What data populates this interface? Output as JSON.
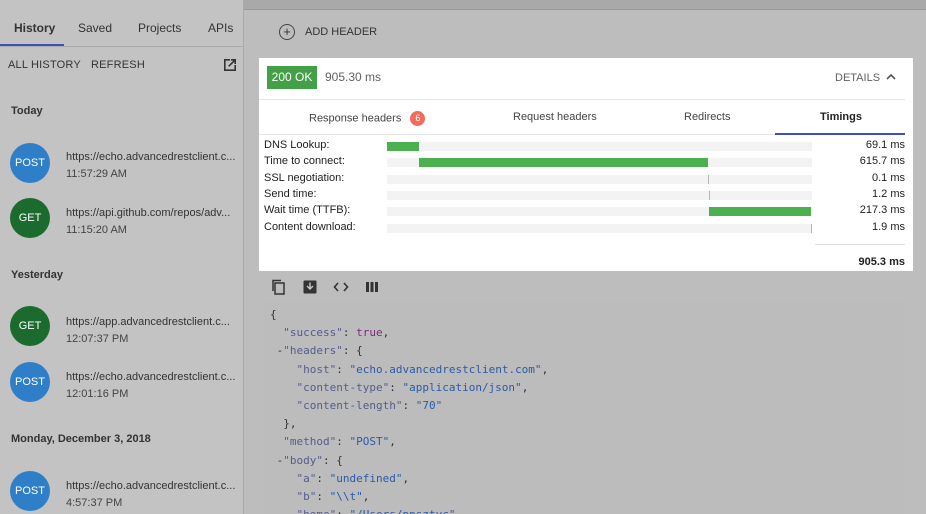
{
  "sidebar": {
    "tabs": [
      {
        "label": "History"
      },
      {
        "label": "Saved"
      },
      {
        "label": "Projects"
      },
      {
        "label": "APIs"
      }
    ],
    "actions": {
      "all_history": "ALL HISTORY",
      "refresh": "REFRESH"
    },
    "sections": [
      {
        "heading": "Today",
        "items": [
          {
            "method": "POST",
            "url": "https://echo.advancedrestclient.c...",
            "time": "11:57:29 AM"
          },
          {
            "method": "GET",
            "url": "https://api.github.com/repos/adv...",
            "time": "11:15:20 AM"
          }
        ]
      },
      {
        "heading": "Yesterday",
        "items": [
          {
            "method": "GET",
            "url": "https://app.advancedrestclient.c...",
            "time": "12:07:37 PM"
          },
          {
            "method": "POST",
            "url": "https://echo.advancedrestclient.c...",
            "time": "12:01:16 PM"
          }
        ]
      },
      {
        "heading": "Monday, December 3, 2018",
        "items": [
          {
            "method": "POST",
            "url": "https://echo.advancedrestclient.c...",
            "time": "4:57:37 PM"
          }
        ]
      }
    ]
  },
  "main": {
    "add_header": "ADD HEADER",
    "response": {
      "status": "200 OK",
      "load_time": "905.30 ms",
      "details": "DETAILS",
      "tabs": [
        {
          "label": "Response headers",
          "badge": "6"
        },
        {
          "label": "Request headers"
        },
        {
          "label": "Redirects"
        },
        {
          "label": "Timings"
        }
      ],
      "timings": [
        {
          "label": "DNS Lookup:",
          "value": "69.1 ms",
          "start": 0.0,
          "end": 0.0763
        },
        {
          "label": "Time to connect:",
          "value": "615.7 ms",
          "start": 0.0763,
          "end": 0.7564
        },
        {
          "label": "SSL negotiation:",
          "value": "0.1 ms",
          "start": 0.7564,
          "end": 0.7565
        },
        {
          "label": "Send time:",
          "value": "1.2 ms",
          "start": 0.7565,
          "end": 0.7578
        },
        {
          "label": "Wait time (TTFB):",
          "value": "217.3 ms",
          "start": 0.7578,
          "end": 0.9979
        },
        {
          "label": "Content download:",
          "value": "1.9 ms",
          "start": 0.9979,
          "end": 1.0
        }
      ],
      "total": "905.3 ms"
    },
    "code_lines": [
      "{",
      "  \"success\": true,",
      " -\"headers\": {",
      "    \"host\": \"echo.advancedrestclient.com\",",
      "    \"content-type\": \"application/json\",",
      "    \"content-length\": \"70\"",
      "  },",
      "  \"method\": \"POST\",",
      " -\"body\": {",
      "    \"a\": \"undefined\",",
      "    \"b\": \"\\\\t\",",
      "    \"home\": \"/Users/ppsztyc\""
    ]
  }
}
